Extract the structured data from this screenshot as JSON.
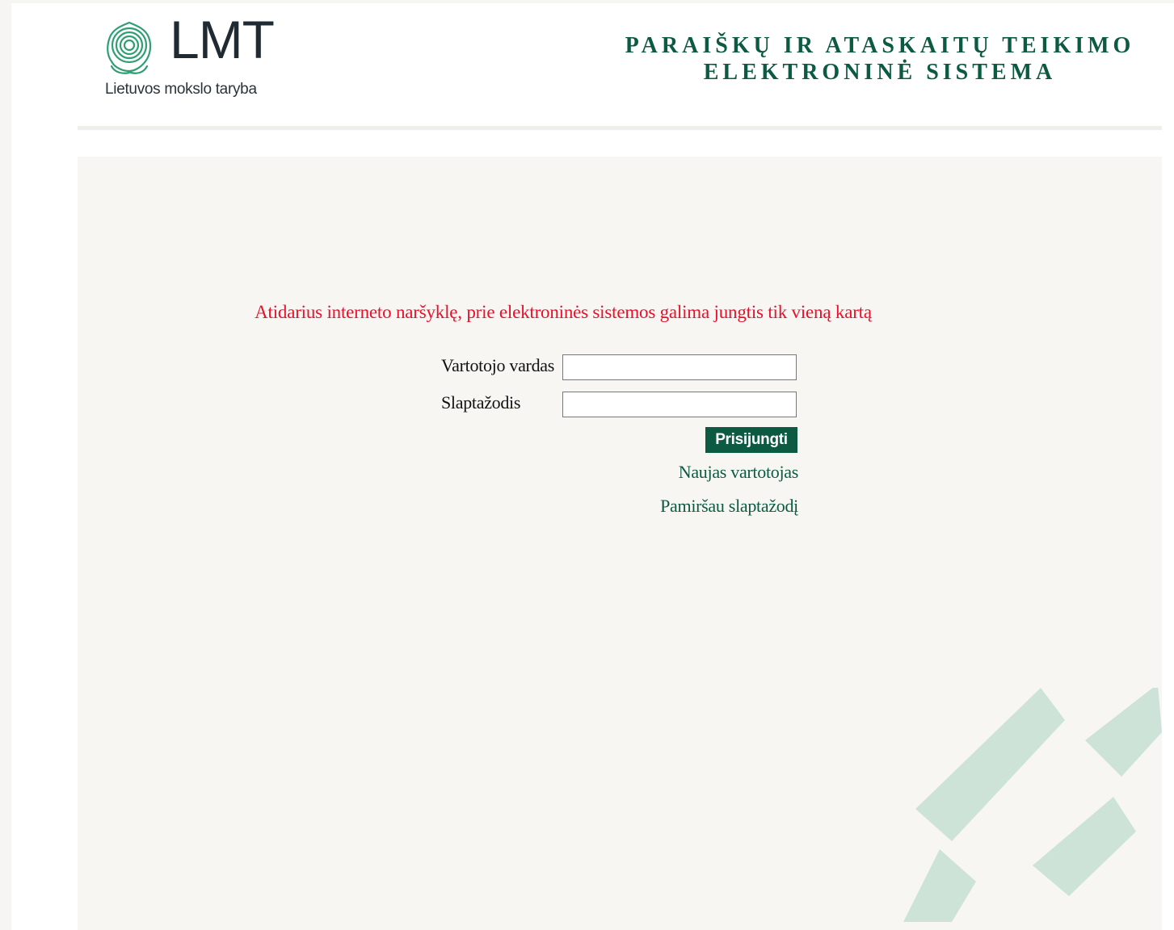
{
  "header": {
    "logo_text": "LMT",
    "logo_subtitle": "Lietuvos mokslo taryba",
    "title_line1": "PARAIŠKŲ IR ATASKAITŲ TEIKIMO",
    "title_line2": "ELEKTRONINĖ SISTEMA"
  },
  "login": {
    "warning": "Atidarius interneto naršyklę, prie elektroninės sistemos galima jungtis tik vieną kartą",
    "username_label": "Vartotojo vardas",
    "username_value": "",
    "password_label": "Slaptažodis",
    "password_value": "",
    "submit_label": "Prisijungti",
    "new_user_link": "Naujas vartotojas",
    "forgot_password_link": "Pamiršau slaptažodį"
  },
  "colors": {
    "brand_green": "#0d5a42",
    "warning_red": "#e8102a",
    "logo_green": "#2f9e73",
    "decor_green": "#cde3d8"
  },
  "icons": {
    "logo_mark": "lmt-rosette-icon",
    "decoration": "diagonal-stripes-decoration"
  }
}
